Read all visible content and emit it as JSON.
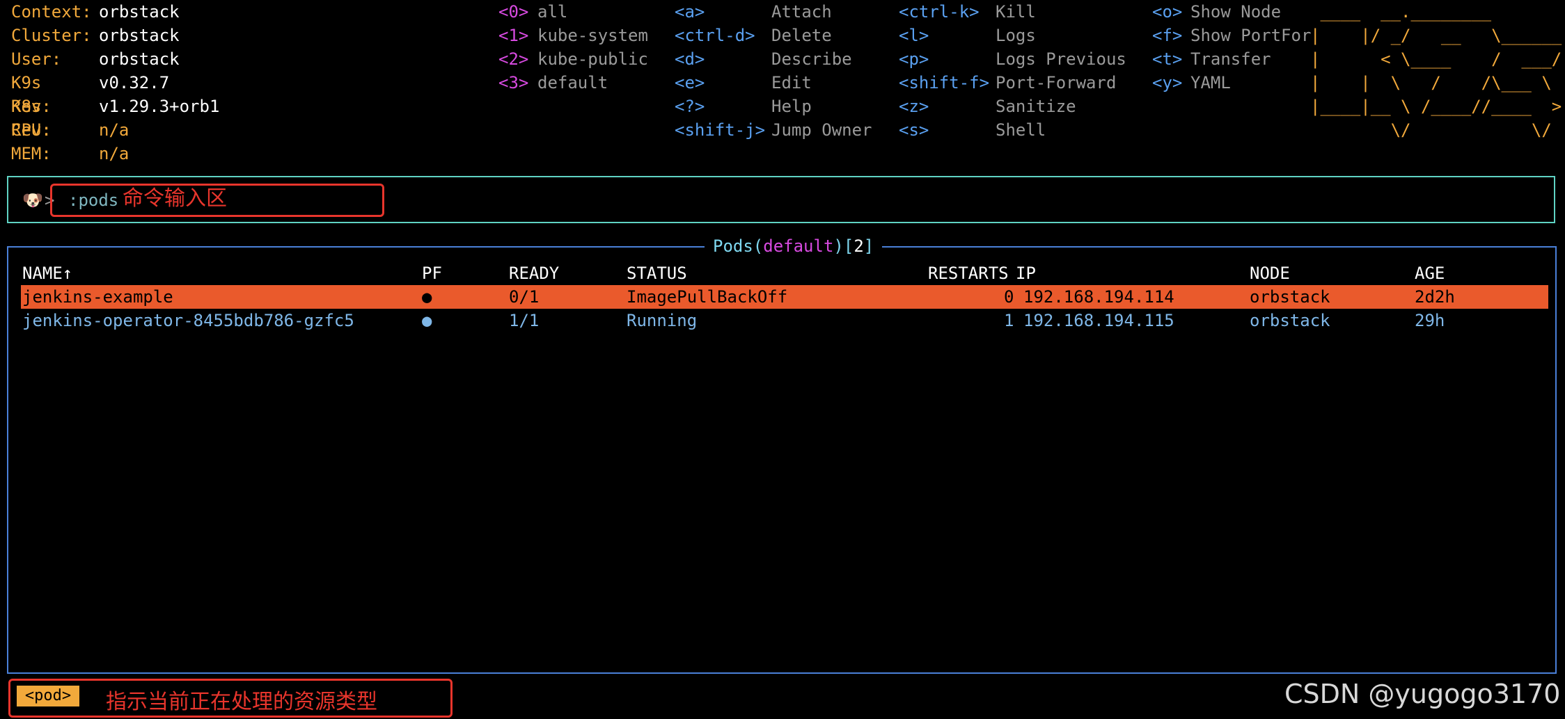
{
  "header": {
    "info": [
      {
        "key": "Context:",
        "value": "orbstack",
        "na": false
      },
      {
        "key": "Cluster:",
        "value": "orbstack",
        "na": false
      },
      {
        "key": "User:",
        "value": "orbstack",
        "na": false
      },
      {
        "key": "K9s Rev:",
        "value": "v0.32.7",
        "na": false
      },
      {
        "key": "K8s Rev:",
        "value": "v1.29.3+orb1",
        "na": false
      },
      {
        "key": "CPU:",
        "value": "n/a",
        "na": true
      },
      {
        "key": "MEM:",
        "value": "n/a",
        "na": true
      }
    ],
    "namespaces": [
      {
        "key": "<0>",
        "label": "all"
      },
      {
        "key": "<1>",
        "label": "kube-system"
      },
      {
        "key": "<2>",
        "label": "kube-public"
      },
      {
        "key": "<3>",
        "label": "default"
      }
    ],
    "shortcuts_col1": [
      {
        "key": "<a>",
        "label": "Attach"
      },
      {
        "key": "<ctrl-d>",
        "label": "Delete"
      },
      {
        "key": "<d>",
        "label": "Describe"
      },
      {
        "key": "<e>",
        "label": "Edit"
      },
      {
        "key": "<?>",
        "label": "Help"
      },
      {
        "key": "<shift-j>",
        "label": "Jump Owner"
      }
    ],
    "shortcuts_col2": [
      {
        "key": "<ctrl-k>",
        "label": "Kill"
      },
      {
        "key": "<l>",
        "label": "Logs"
      },
      {
        "key": "<p>",
        "label": "Logs Previous"
      },
      {
        "key": "<shift-f>",
        "label": "Port-Forward"
      },
      {
        "key": "<z>",
        "label": "Sanitize"
      },
      {
        "key": "<s>",
        "label": "Shell"
      }
    ],
    "shortcuts_col3": [
      {
        "key": "<o>",
        "label": "Show Node"
      },
      {
        "key": "<f>",
        "label": "Show PortFor"
      },
      {
        "key": "<t>",
        "label": "Transfer"
      },
      {
        "key": "<y>",
        "label": "YAML"
      }
    ],
    "logo": " ____  __.________       \n|    |/ _/   __   \\______\n|      < \\____    /  ___/\n|    |  \\   /    /\\___ \\ \n|____|__ \\ /____//____  >\n        \\/            \\/ "
  },
  "command": {
    "prompt_icon": "🐶",
    "caret": ">",
    "value": ":pods",
    "annotation": "命令输入区"
  },
  "pods": {
    "title_prefix": "Pods(",
    "namespace": "default",
    "title_mid": ")[",
    "count": "2",
    "title_suffix": "]",
    "columns": [
      "NAME↑",
      "PF",
      "READY",
      "STATUS",
      "RESTARTS",
      "IP",
      "NODE",
      "AGE"
    ],
    "rows": [
      {
        "name": "jenkins-example",
        "pf": "●",
        "ready": "0/1",
        "status": "ImagePullBackOff",
        "restarts": "0",
        "ip": "192.168.194.114",
        "node": "orbstack",
        "age": "2d2h",
        "selected": true
      },
      {
        "name": "jenkins-operator-8455bdb786-gzfc5",
        "pf": "●",
        "ready": "1/1",
        "status": "Running",
        "restarts": "1",
        "ip": "192.168.194.115",
        "node": "orbstack",
        "age": "29h",
        "selected": false
      }
    ]
  },
  "footer": {
    "resource_badge": "<pod>",
    "annotation": "指示当前正在处理的资源类型",
    "watermark": "CSDN @yugogo3170"
  },
  "colors": {
    "accent_orange": "#f2a93b",
    "selected_row": "#ea5a2c",
    "annotation_red": "#e8352c",
    "panel_border": "#4a80d8",
    "command_border": "#5fd3c4"
  }
}
